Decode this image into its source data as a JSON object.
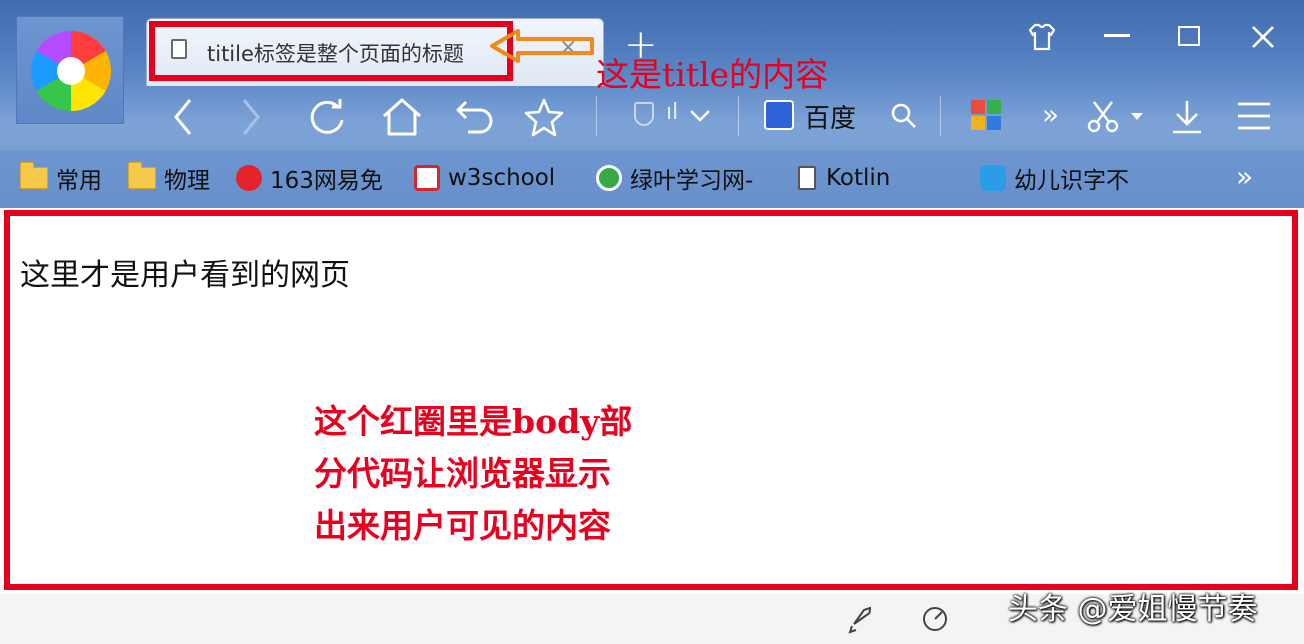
{
  "browser": {
    "tab": {
      "title": "titile标签是整个页面的标题",
      "close_label": "×"
    },
    "new_tab_label": "+",
    "annotation_title": "这是title的内容",
    "window_controls": {
      "skin": "skin-icon",
      "minimize": "—",
      "maximize": "□",
      "close": "✕"
    },
    "toolbar": {
      "back": "back-icon",
      "forward": "forward-icon",
      "refresh": "refresh-icon",
      "home": "home-icon",
      "undo": "undo-icon",
      "favorite": "star-icon",
      "signal_label": "ıl",
      "search_engine_label": "百度",
      "more_label": "»"
    },
    "bookmarks": [
      {
        "label": "常用",
        "icon": "folder-icon"
      },
      {
        "label": "物理",
        "icon": "folder-icon"
      },
      {
        "label": "163网易免",
        "icon": "netease-icon"
      },
      {
        "label": "w3school",
        "icon": "w3school-icon"
      },
      {
        "label": "绿叶学习网-",
        "icon": "lvye-icon"
      },
      {
        "label": "Kotlin",
        "icon": "page-icon"
      },
      {
        "label": "幼儿识字不",
        "icon": "bilibili-icon"
      }
    ],
    "bookmarks_more": "»"
  },
  "page": {
    "content_text": "这里才是用户看到的网页",
    "annotation_body": [
      "这个红圈里是body部",
      "分代码让浏览器显示",
      "出来用户可见的内容"
    ]
  },
  "watermark": "头条 @爱姐慢节奏",
  "colors": {
    "highlight": "#e6001c",
    "chrome": "#5a86c6"
  }
}
